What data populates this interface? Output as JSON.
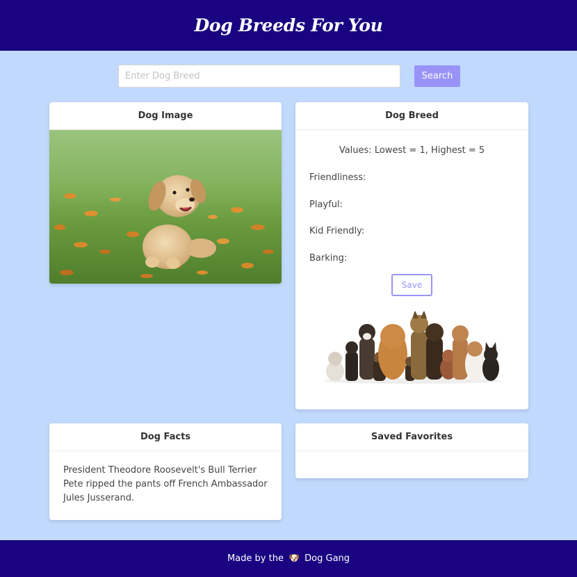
{
  "header": {
    "title": "Dog Breeds For You"
  },
  "search": {
    "placeholder": "Enter Dog Breed",
    "value": "",
    "button_label": "Search"
  },
  "image_card": {
    "title": "Dog Image",
    "image": "golden-retriever-puppy-in-flower-field"
  },
  "breed_card": {
    "title": "Dog Breed",
    "values_note": "Values: Lowest = 1, Highest = 5",
    "traits": [
      {
        "label": "Friendliness:"
      },
      {
        "label": "Playful:"
      },
      {
        "label": "Kid Friendly:"
      },
      {
        "label": "Barking:"
      }
    ],
    "save_label": "Save",
    "image": "group-of-dogs"
  },
  "facts_card": {
    "title": "Dog Facts",
    "fact": "President Theodore Roosevelt's Bull Terrier Pete ripped the pants off French Ambassador Jules Jusserand."
  },
  "favorites_card": {
    "title": "Saved Favorites",
    "items": []
  },
  "footer": {
    "prefix": "Made by the",
    "icon": "dog-face-icon",
    "suffix": "Dog Gang"
  },
  "colors": {
    "header_bg": "#190381",
    "page_bg": "#c0d9fc",
    "accent": "#9993f8"
  }
}
